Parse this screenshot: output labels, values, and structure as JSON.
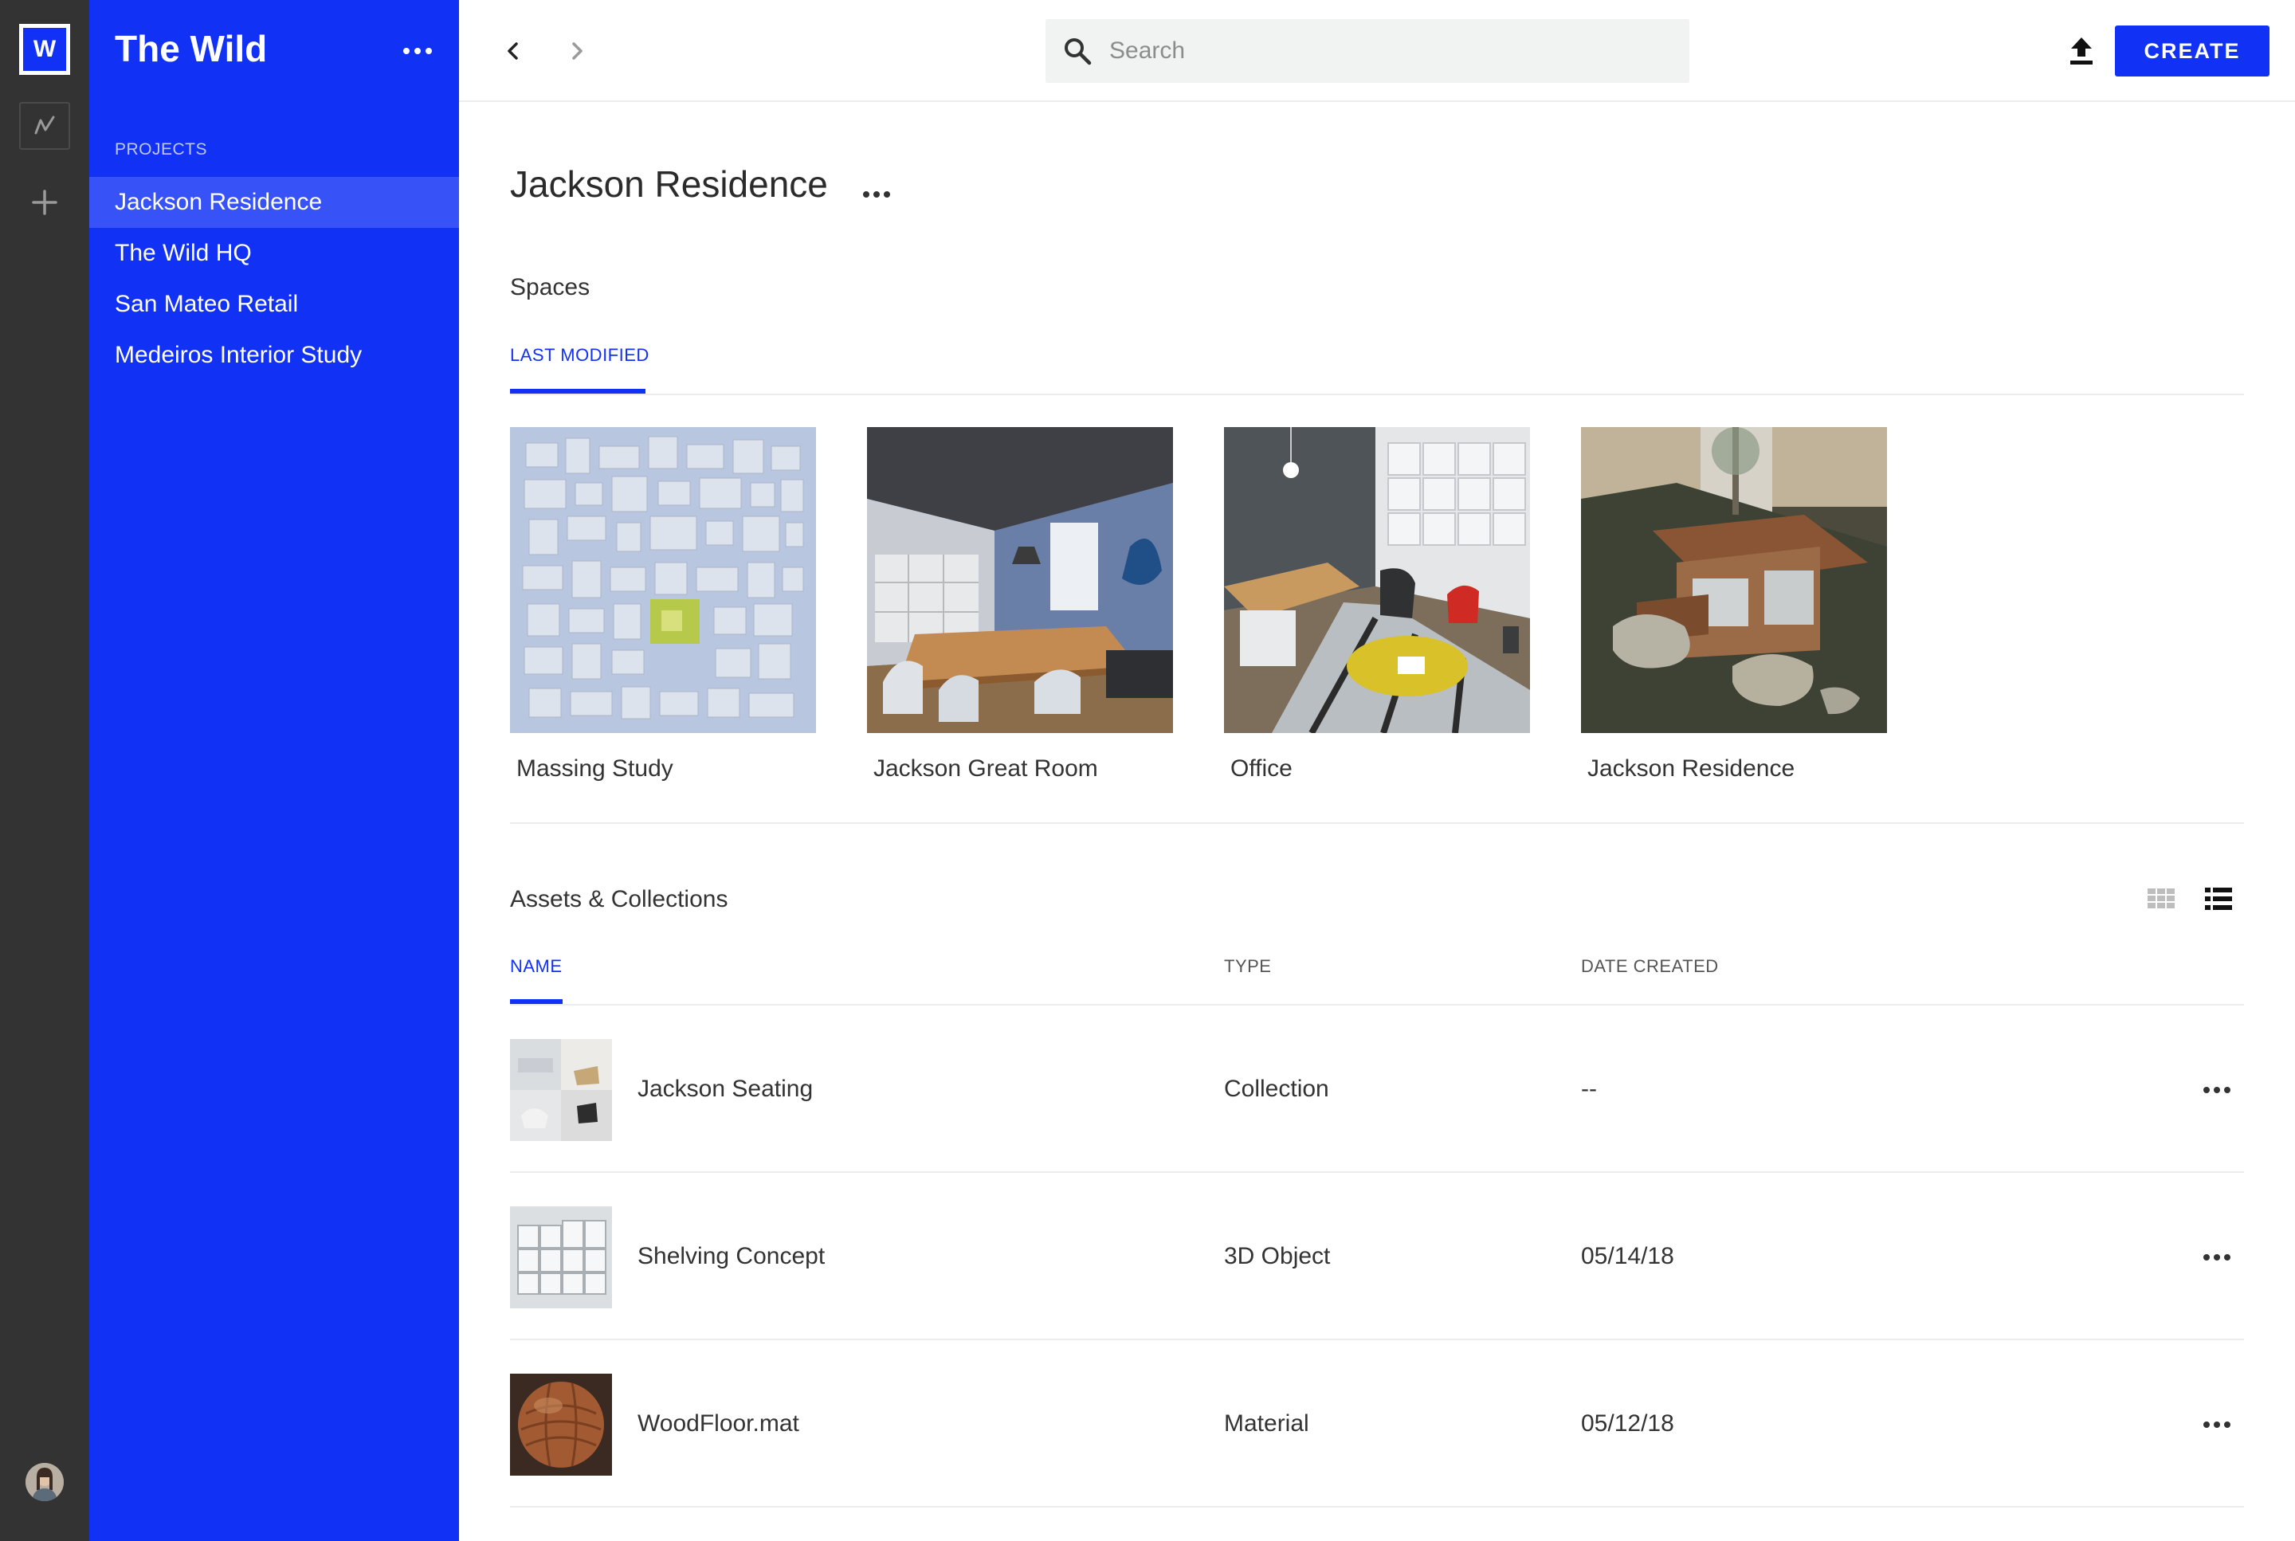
{
  "rail": {
    "logo_letter": "W",
    "icons": [
      "workspace-icon",
      "plus-icon",
      "avatar"
    ]
  },
  "sidebar": {
    "title": "The Wild",
    "section_label": "PROJECTS",
    "items": [
      {
        "label": "Jackson Residence",
        "active": true
      },
      {
        "label": "The Wild HQ",
        "active": false
      },
      {
        "label": "San Mateo Retail",
        "active": false
      },
      {
        "label": "Medeiros Interior Study",
        "active": false
      }
    ]
  },
  "topbar": {
    "search_placeholder": "Search",
    "create_label": "CREATE"
  },
  "main": {
    "title": "Jackson Residence",
    "spaces": {
      "label": "Spaces",
      "tab": "LAST MODIFIED",
      "items": [
        {
          "name": "Massing Study"
        },
        {
          "name": "Jackson Great Room"
        },
        {
          "name": "Office"
        },
        {
          "name": "Jackson Residence"
        }
      ]
    },
    "assets": {
      "label": "Assets & Collections",
      "columns": {
        "name": "NAME",
        "type": "TYPE",
        "date": "DATE CREATED"
      },
      "rows": [
        {
          "name": "Jackson Seating",
          "type": "Collection",
          "date": "--"
        },
        {
          "name": "Shelving Concept",
          "type": "3D Object",
          "date": "05/14/18"
        },
        {
          "name": "WoodFloor.mat",
          "type": "Material",
          "date": "05/12/18"
        }
      ]
    }
  },
  "colors": {
    "accent": "#1131f5",
    "rail": "#333333",
    "divider": "#ececec"
  }
}
